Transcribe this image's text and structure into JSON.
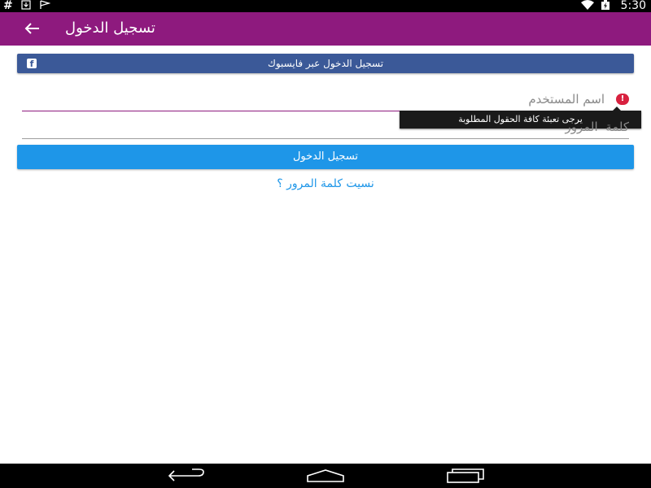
{
  "status_bar": {
    "left_icons": [
      "hash-icon",
      "download-icon",
      "flag-icon"
    ],
    "right_icons": [
      "wifi-icon",
      "battery-charging-icon"
    ],
    "time": "5:30"
  },
  "app_bar": {
    "title": "تسجيل الدخول",
    "background": "#8e1a7e"
  },
  "facebook_button": {
    "label": "تسجيل الدخول عبر فايسبوك",
    "icon": "facebook-icon",
    "color": "#3b5998"
  },
  "username_field": {
    "placeholder": "اسم المستخدم",
    "value": "",
    "error_icon": "error-icon"
  },
  "error_tooltip": {
    "text": "يرجى تعبئة كافة الحقول المطلوبة"
  },
  "password_field": {
    "placeholder": "كلمة  المرور",
    "value": ""
  },
  "login_button": {
    "label": "تسجيل الدخول",
    "color": "#1e96e8"
  },
  "forgot_password": {
    "label": "نسيت كلمة المرور ؟"
  },
  "nav_bar": {
    "icons": [
      "back-nav-icon",
      "home-nav-icon",
      "recents-nav-icon"
    ]
  }
}
